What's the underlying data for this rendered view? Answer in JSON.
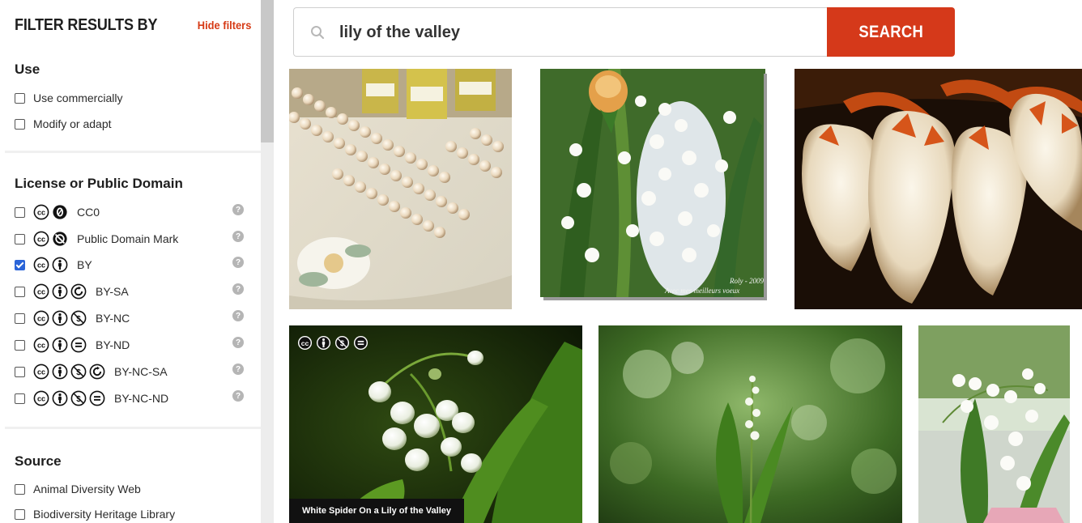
{
  "filters": {
    "title": "FILTER RESULTS BY",
    "hide_label": "Hide filters",
    "use": {
      "title": "Use",
      "items": [
        {
          "label": "Use commercially",
          "checked": false
        },
        {
          "label": "Modify or adapt",
          "checked": false
        }
      ]
    },
    "license": {
      "title": "License or Public Domain",
      "items": [
        {
          "label": "CC0",
          "checked": false,
          "icons": [
            "cc-icon",
            "zero-icon"
          ]
        },
        {
          "label": "Public Domain Mark",
          "checked": false,
          "icons": [
            "cc-icon",
            "no-copyright-icon"
          ]
        },
        {
          "label": "BY",
          "checked": true,
          "icons": [
            "cc-icon",
            "by-icon"
          ]
        },
        {
          "label": "BY-SA",
          "checked": false,
          "icons": [
            "cc-icon",
            "by-icon",
            "sa-icon"
          ]
        },
        {
          "label": "BY-NC",
          "checked": false,
          "icons": [
            "cc-icon",
            "by-icon",
            "nc-icon"
          ]
        },
        {
          "label": "BY-ND",
          "checked": false,
          "icons": [
            "cc-icon",
            "by-icon",
            "nd-icon"
          ]
        },
        {
          "label": "BY-NC-SA",
          "checked": false,
          "icons": [
            "cc-icon",
            "by-icon",
            "nc-icon",
            "sa-icon"
          ]
        },
        {
          "label": "BY-NC-ND",
          "checked": false,
          "icons": [
            "cc-icon",
            "by-icon",
            "nc-icon",
            "nd-icon"
          ]
        }
      ],
      "help_glyph": "?"
    },
    "source": {
      "title": "Source",
      "items": [
        {
          "label": "Animal Diversity Web",
          "checked": false
        },
        {
          "label": "Biodiversity Heritage Library",
          "checked": false
        }
      ]
    }
  },
  "search": {
    "value": "lily of the valley",
    "button_label": "SEARCH"
  },
  "results": [
    {
      "caption": "",
      "license_icons": []
    },
    {
      "caption": "",
      "license_icons": [],
      "overlay_text": "Roly - 2009\nAvec mes meilleurs voeux"
    },
    {
      "caption": "",
      "license_icons": []
    },
    {
      "caption": "White Spider On a Lily of the Valley",
      "license_icons": [
        "cc-icon",
        "by-icon",
        "nc-icon",
        "nd-icon"
      ]
    },
    {
      "caption": "",
      "license_icons": []
    },
    {
      "caption": "",
      "license_icons": []
    }
  ],
  "colors": {
    "accent": "#d5391a",
    "check": "#2a64d8"
  }
}
